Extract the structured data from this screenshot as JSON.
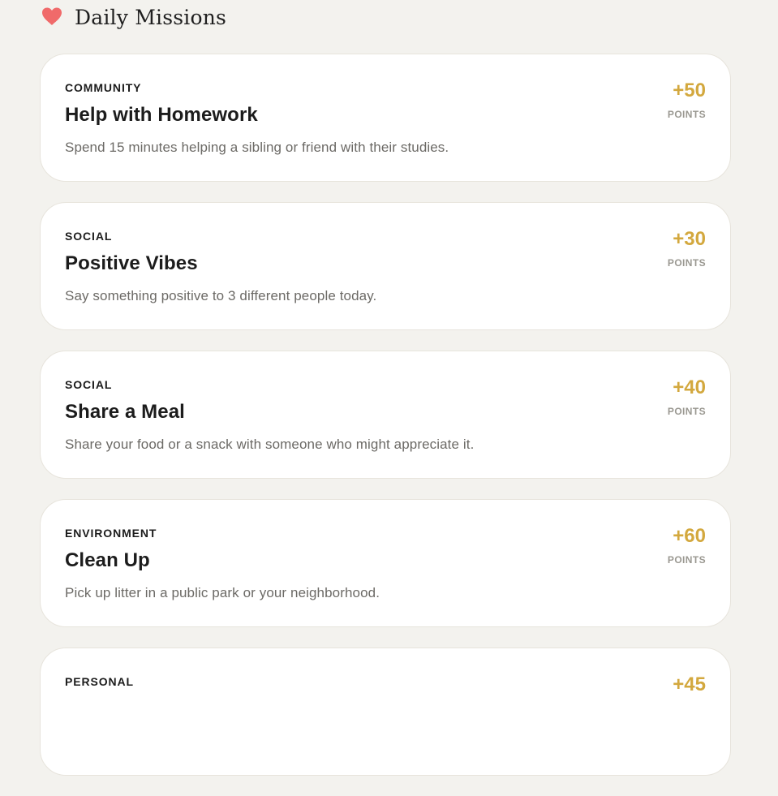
{
  "header": {
    "icon": "heart-icon",
    "title": "Daily Missions",
    "icon_color": "#f06a6a"
  },
  "missions": [
    {
      "category": "COMMUNITY",
      "title": "Help with Homework",
      "description": "Spend 15 minutes helping a sibling or friend with their studies.",
      "points_value": "+50",
      "points_label": "POINTS"
    },
    {
      "category": "SOCIAL",
      "title": "Positive Vibes",
      "description": "Say something positive to 3 different people today.",
      "points_value": "+30",
      "points_label": "POINTS"
    },
    {
      "category": "SOCIAL",
      "title": "Share a Meal",
      "description": "Share your food or a snack with someone who might appreciate it.",
      "points_value": "+40",
      "points_label": "POINTS"
    },
    {
      "category": "ENVIRONMENT",
      "title": "Clean Up",
      "description": "Pick up litter in a public park or your neighborhood.",
      "points_value": "+60",
      "points_label": "POINTS"
    },
    {
      "category": "PERSONAL",
      "title": "",
      "description": "",
      "points_value": "+45",
      "points_label": ""
    }
  ],
  "colors": {
    "background": "#f3f2ee",
    "card": "#ffffff",
    "accent": "#d3a83e",
    "muted_text": "#6c6a66"
  }
}
